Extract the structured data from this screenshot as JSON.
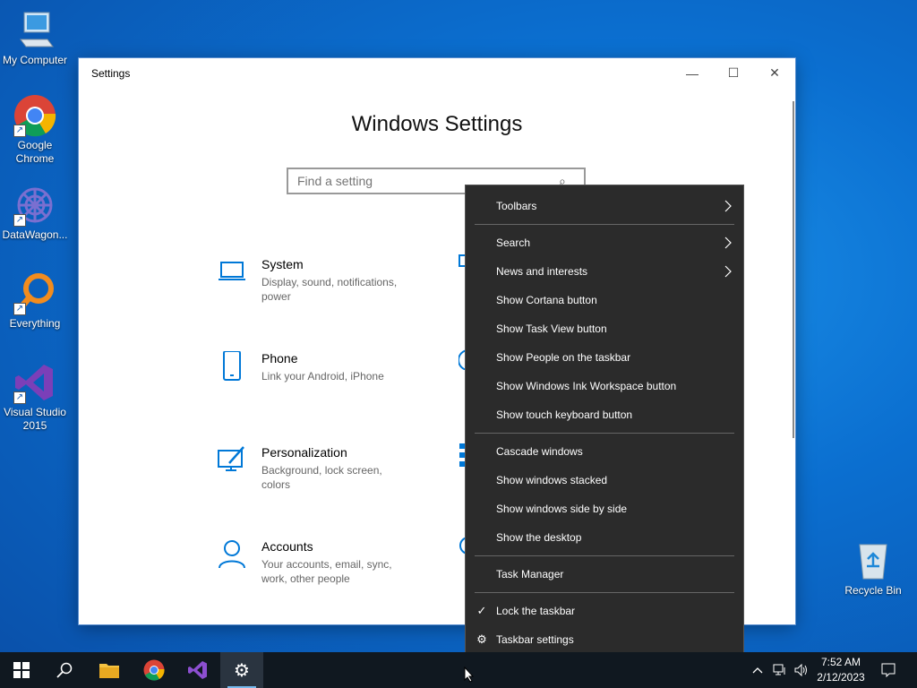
{
  "desktop": {
    "icons": [
      {
        "label": "My Computer"
      },
      {
        "label": "Google Chrome"
      },
      {
        "label": "DataWagon..."
      },
      {
        "label": "Everything"
      },
      {
        "label": "Visual Studio 2015"
      },
      {
        "label": "Recycle Bin"
      }
    ]
  },
  "window": {
    "title": "Settings",
    "minimize": "—",
    "maximize": "☐",
    "close": "✕",
    "heading": "Windows Settings",
    "search_placeholder": "Find a setting",
    "tiles": [
      {
        "name": "System",
        "desc": "Display, sound, notifications, power",
        "icon": "laptop-icon"
      },
      {
        "name": "Phone",
        "desc": "Link your Android, iPhone",
        "icon": "phone-icon"
      },
      {
        "name": "Personalization",
        "desc": "Background, lock screen, colors",
        "icon": "personalization-icon"
      },
      {
        "name": "Accounts",
        "desc": "Your accounts, email, sync, work, other people",
        "icon": "person-icon"
      }
    ]
  },
  "context_menu": {
    "items": [
      {
        "label": "Toolbars",
        "submenu": true
      },
      {
        "label": "Search",
        "submenu": true
      },
      {
        "label": "News and interests",
        "submenu": true
      },
      {
        "label": "Show Cortana button"
      },
      {
        "label": "Show Task View button"
      },
      {
        "label": "Show People on the taskbar"
      },
      {
        "label": "Show Windows Ink Workspace button"
      },
      {
        "label": "Show touch keyboard button"
      },
      {
        "label": "Cascade windows"
      },
      {
        "label": "Show windows stacked"
      },
      {
        "label": "Show windows side by side"
      },
      {
        "label": "Show the desktop"
      },
      {
        "label": "Task Manager"
      },
      {
        "label": "Lock the taskbar",
        "checked": true
      },
      {
        "label": "Taskbar settings",
        "icon": "gear-icon"
      }
    ]
  },
  "taskbar": {
    "apps": [
      "start-button",
      "search-button",
      "file-explorer",
      "google-chrome",
      "visual-studio",
      "settings"
    ],
    "clock_time": "7:52 AM",
    "clock_date": "2/12/2023"
  },
  "colors": {
    "accent": "#0078d7",
    "menu_bg": "#2b2b2b",
    "taskbar_bg": "#101820"
  }
}
